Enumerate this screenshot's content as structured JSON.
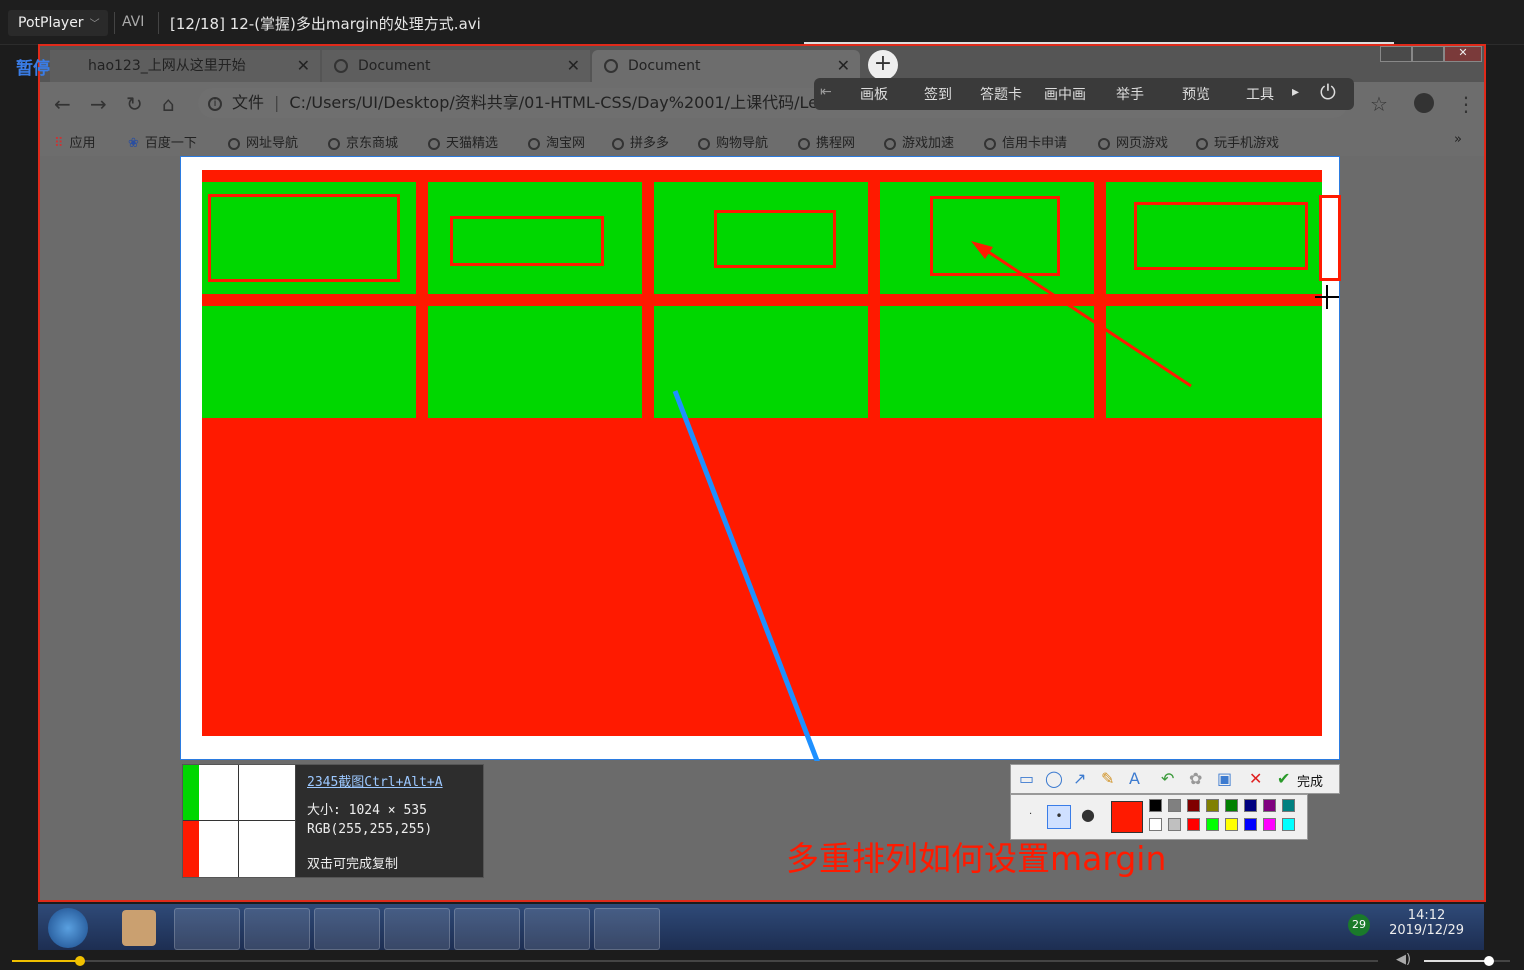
{
  "player": {
    "name": "PotPlayer",
    "format": "AVI",
    "file_title": "[12/18] 12-(掌握)多出margin的处理方式.avi",
    "status": "暂停"
  },
  "browser": {
    "tabs": [
      {
        "label": "hao123_上网从这里开始"
      },
      {
        "label": "Document"
      },
      {
        "label": "Document"
      }
    ],
    "address_prefix": "文件",
    "address": "C:/Users/UI/Desktop/资料共享/01-HTML-CSS/Day%2001/上课代码/Lea",
    "bookmarks": [
      "应用",
      "百度一下",
      "网址导航",
      "京东商城",
      "天猫精选",
      "淘宝网",
      "拼多多",
      "购物导航",
      "携程网",
      "游戏加速",
      "信用卡申请",
      "网页游戏",
      "玩手机游戏"
    ]
  },
  "classroom_toolbar": [
    "画板",
    "签到",
    "答题卡",
    "画中画",
    "举手",
    "预览",
    "工具"
  ],
  "capture_info": {
    "title": "2345截图Ctrl+Alt+A",
    "size": "大小: 1024 × 535",
    "rgb": "RGB(255,255,255)",
    "hint": "双击可完成复制"
  },
  "shot_tool": {
    "done_label": "完成"
  },
  "annotation_text": "多重排列如何设置margin",
  "colors": {
    "red": "#ff1a00",
    "green": "#00d700",
    "arrow_blue": "#1e90ff",
    "palette": [
      "#000000",
      "#808080",
      "#800000",
      "#808000",
      "#008000",
      "#000080",
      "#800080",
      "#008080",
      "#ffffff",
      "#c0c0c0",
      "#ff0000",
      "#00ff00",
      "#ffff00",
      "#0000ff",
      "#ff00ff",
      "#00ffff"
    ]
  },
  "taskbar": {
    "time": "14:12",
    "date": "2019/12/29",
    "badge": "29"
  },
  "playback": {
    "progress": 0.05,
    "volume": 0.75
  }
}
